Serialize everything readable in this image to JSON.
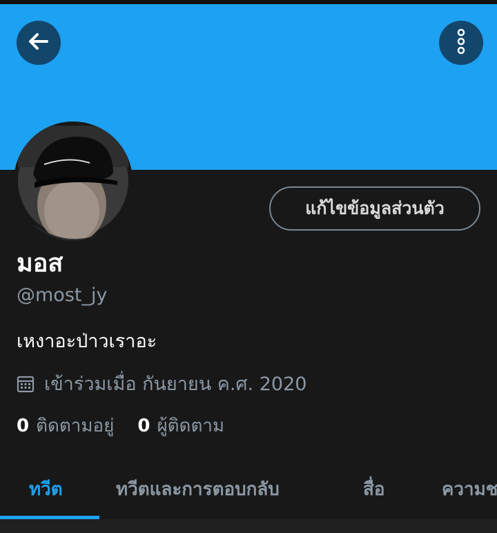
{
  "header": {
    "back_icon": "arrow-left-icon",
    "menu_icon": "more-vertical-icon",
    "banner_color": "#1da1f2"
  },
  "profile": {
    "avatar_icon": "profile-photo",
    "edit_label": "แก้ไขข้อมูลส่วนตัว",
    "display_name": "มอส",
    "handle": "@most_jy",
    "bio": "เหงาอะป่าวเราอะ",
    "joined_icon": "calendar-icon",
    "joined": "เข้าร่วมเมื่อ กันยายน ค.ศ. 2020",
    "following_count": "0",
    "following_label": "ติดตามอยู่",
    "followers_count": "0",
    "followers_label": "ผู้ติดตาม"
  },
  "tabs": [
    {
      "label": "ทวีต",
      "active": true
    },
    {
      "label": "ทวีตและการตอบกลับ",
      "active": false
    },
    {
      "label": "สื่อ",
      "active": false
    },
    {
      "label": "ความชอบ",
      "active": false
    }
  ],
  "colors": {
    "accent": "#1da1f2",
    "background": "#181818",
    "muted_text": "#8b98a5"
  }
}
